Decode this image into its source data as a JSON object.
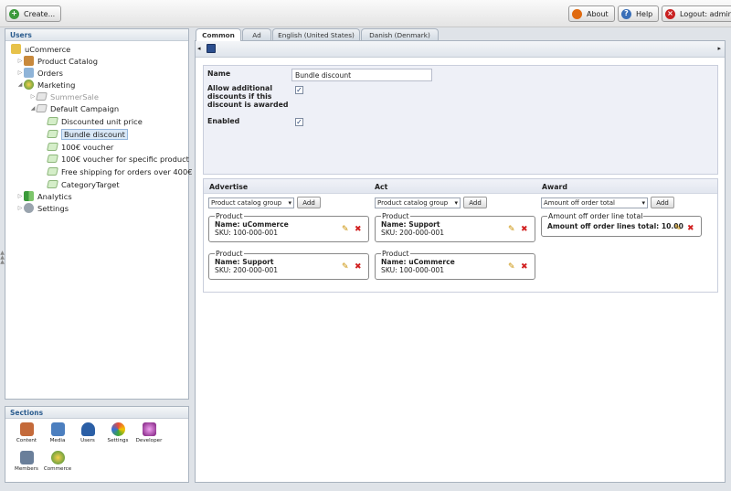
{
  "toolbar": {
    "create_label": "Create...",
    "about_label": "About",
    "help_label": "Help",
    "logout_label": "Logout: admin"
  },
  "tree": {
    "title": "Users",
    "root": "uCommerce",
    "items": [
      {
        "label": "Product Catalog"
      },
      {
        "label": "Orders"
      },
      {
        "label": "Marketing"
      },
      {
        "label": "SummerSale"
      },
      {
        "label": "Default Campaign"
      },
      {
        "label": "Discounted unit price"
      },
      {
        "label": "Bundle discount"
      },
      {
        "label": "100€ voucher"
      },
      {
        "label": "100€ voucher for specific product"
      },
      {
        "label": "Free shipping for orders over 400€"
      },
      {
        "label": "CategoryTarget"
      },
      {
        "label": "Analytics"
      },
      {
        "label": "Settings"
      }
    ]
  },
  "sections": {
    "title": "Sections",
    "items": [
      {
        "label": "Content",
        "color": "#c46a3a"
      },
      {
        "label": "Media",
        "color": "#4c7fbf"
      },
      {
        "label": "Users",
        "color": "#2b5fa6"
      },
      {
        "label": "Settings",
        "color": "#e5a800"
      },
      {
        "label": "Developer",
        "color": "#b23aa8"
      },
      {
        "label": "Members",
        "color": "#6a7f9a"
      },
      {
        "label": "Commerce",
        "color": "#5fae3a"
      }
    ]
  },
  "tabs": [
    {
      "label": "Common",
      "active": true
    },
    {
      "label": "Ad"
    },
    {
      "label": "English (United States)"
    },
    {
      "label": "Danish (Denmark)"
    }
  ],
  "form": {
    "name_label": "Name",
    "name_value": "Bundle discount",
    "allow_label_1": "Allow additional",
    "allow_label_2": "discounts if this",
    "allow_label_3": "discount is awarded",
    "allow_checked": "✓",
    "enabled_label": "Enabled",
    "enabled_checked": "✓"
  },
  "rules": {
    "advertise": {
      "title": "Advertise",
      "select": "Product catalog group",
      "add": "Add",
      "boxes": [
        {
          "legend": "Product",
          "name": "Name: uCommerce",
          "sku": "SKU: 100-000-001"
        },
        {
          "legend": "Product",
          "name": "Name: Support",
          "sku": "SKU: 200-000-001"
        }
      ]
    },
    "act": {
      "title": "Act",
      "select": "Product catalog group",
      "add": "Add",
      "boxes": [
        {
          "legend": "Product",
          "name": "Name: Support",
          "sku": "SKU: 200-000-001"
        },
        {
          "legend": "Product",
          "name": "Name: uCommerce",
          "sku": "SKU: 100-000-001"
        }
      ]
    },
    "award": {
      "title": "Award",
      "select": "Amount off order total",
      "add": "Add",
      "box": {
        "legend": "Amount off order line total",
        "text": "Amount off order lines total: 10.00"
      }
    }
  },
  "colors": {
    "accent": "#2c5d8f",
    "panel_border": "#a9b3bf",
    "selected_bg": "#d9e8f7"
  }
}
